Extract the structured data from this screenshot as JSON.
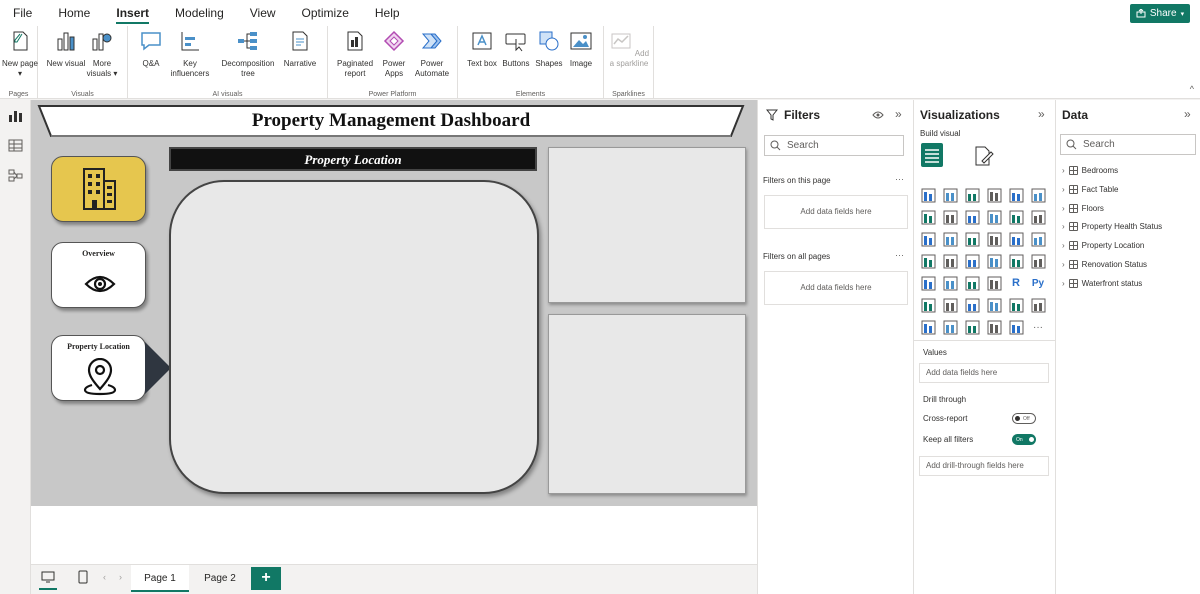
{
  "menu": {
    "tabs": [
      "File",
      "Home",
      "Insert",
      "Modeling",
      "View",
      "Optimize",
      "Help"
    ],
    "active": "Insert",
    "share_label": "Share"
  },
  "ribbon": {
    "groups": {
      "pages": "Pages",
      "visuals": "Visuals",
      "ai_visuals": "AI visuals",
      "power_platform": "Power Platform",
      "elements": "Elements",
      "sparklines": "Sparklines"
    },
    "buttons": {
      "new_page": "New page",
      "new_visual": "New visual",
      "more_visuals": "More visuals",
      "qa": "Q&A",
      "key_influencers": "Key influencers",
      "decomposition_tree": "Decomposition tree",
      "narrative": "Narrative",
      "paginated_report": "Paginated report",
      "power_apps": "Power Apps",
      "power_automate": "Power Automate",
      "text_box": "Text box",
      "buttons": "Buttons",
      "shapes": "Shapes",
      "image": "Image",
      "add_sparkline": "Add a sparkline"
    }
  },
  "report": {
    "title": "Property Management Dashboard",
    "location_header": "Property Location",
    "nav_cards": {
      "overview": "Overview",
      "property_location": "Property Location"
    }
  },
  "page_tabs": [
    "Page 1",
    "Page 2"
  ],
  "active_page": "Page 1",
  "filters": {
    "title": "Filters",
    "search_placeholder": "Search",
    "on_this_page": "Filters on this page",
    "on_all_pages": "Filters on all pages",
    "add_fields": "Add data fields here"
  },
  "visualizations": {
    "title": "Visualizations",
    "build_visual": "Build visual",
    "values_label": "Values",
    "values_well": "Add data fields here",
    "drill_through": "Drill through",
    "cross_report": "Cross-report",
    "cross_report_state": "Off",
    "keep_all_filters": "Keep all filters",
    "keep_all_filters_state": "On",
    "drill_well": "Add drill-through fields here"
  },
  "data": {
    "title": "Data",
    "search_placeholder": "Search",
    "tables": [
      "Bedrooms",
      "Fact Table",
      "Floors",
      "Property Health Status",
      "Property Location",
      "Renovation Status",
      "Waterfront status"
    ]
  },
  "colors": {
    "accent": "#117865",
    "home_card": "#e6c64e",
    "canvas_bg": "#c8c8c8"
  }
}
